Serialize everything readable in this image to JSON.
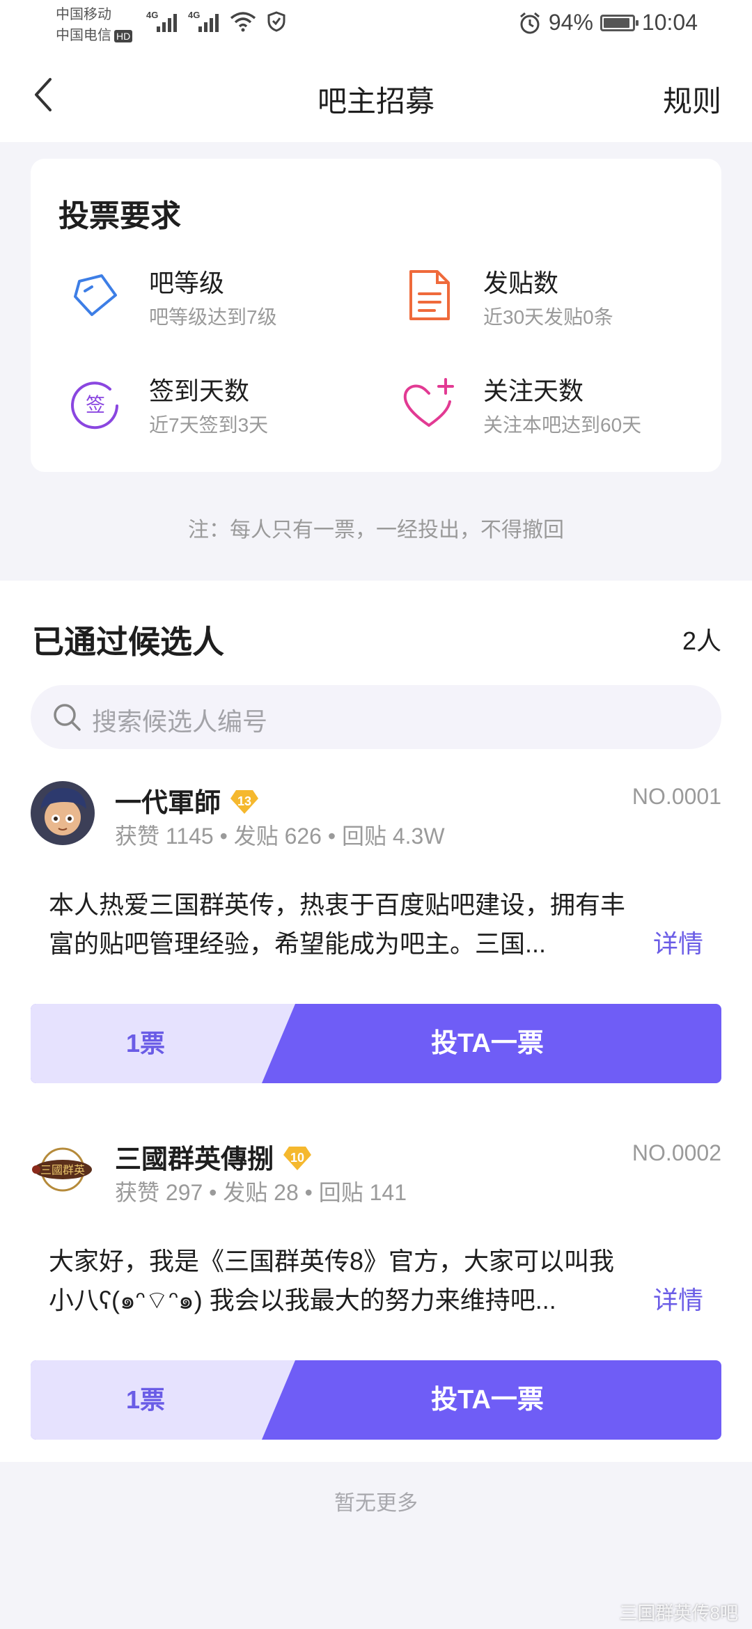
{
  "status_bar": {
    "carrier1": "中国移动",
    "carrier2": "中国电信",
    "hd": "HD",
    "net1": "4G",
    "net2": "4G",
    "battery": "94%",
    "time": "10:04"
  },
  "nav": {
    "title": "吧主招募",
    "rules": "规则"
  },
  "requirements": {
    "title": "投票要求",
    "items": [
      {
        "name": "吧等级",
        "desc": "吧等级达到7级",
        "icon": "diamond-icon",
        "color": "#3d7ee6"
      },
      {
        "name": "发贴数",
        "desc": "近30天发贴0条",
        "icon": "document-icon",
        "color": "#ef6a3b"
      },
      {
        "name": "签到天数",
        "desc": "近7天签到3天",
        "icon": "sign-in-icon",
        "color": "#8a46e0"
      },
      {
        "name": "关注天数",
        "desc": "关注本吧达到60天",
        "icon": "heart-plus-icon",
        "color": "#e23a93"
      }
    ],
    "note": "注：每人只有一票，一经投出，不得撤回"
  },
  "candidates": {
    "title": "已通过候选人",
    "count": "2人",
    "search_placeholder": "搜索候选人编号",
    "list": [
      {
        "name": "一代軍師",
        "level": "13",
        "no": "NO.0001",
        "stats": "获赞 1145 • 发贴 626 • 回贴 4.3W",
        "intro_line1": "本人热爱三国群英传，热衷于百度贴吧建设，拥有丰",
        "intro_line2": "富的贴吧管理经验，希望能成为吧主。三国...",
        "details": "详情",
        "votes": "1票",
        "vote_button": "投TA一票"
      },
      {
        "name": "三國群英傳捌",
        "level": "10",
        "no": "NO.0002",
        "stats": "获赞 297 • 发贴 28 • 回贴 141",
        "intro_line1": "大家好，我是《三国群英传8》官方，大家可以叫我",
        "intro_line2": "小八ʕ(๑ᵔ⌔ᵔ๑) 我会以我最大的努力来维持吧...",
        "details": "详情",
        "votes": "1票",
        "vote_button": "投TA一票"
      }
    ]
  },
  "footer": {
    "no_more": "暂无更多",
    "watermark": "三国群英传8吧"
  },
  "colors": {
    "accent": "#6f5df6",
    "accent_light": "#e6e2fe",
    "badge_gold": "#f5b82e"
  }
}
